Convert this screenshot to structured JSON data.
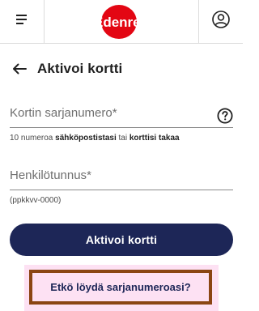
{
  "header": {
    "brand": "Edenred",
    "brand_color": "#e30613",
    "menu_icon": "hamburger-menu-icon",
    "profile_icon": "user-circle-icon"
  },
  "page": {
    "title": "Aktivoi kortti",
    "back_icon": "arrow-left-icon"
  },
  "form": {
    "serial": {
      "label": "Kortin sarjanumero",
      "required_mark": "*",
      "helper_prefix": "10 numeroa ",
      "helper_bold1": "sähköpostistasi",
      "helper_mid": " tai ",
      "helper_bold2": "korttisi takaa",
      "help_icon": "question-circle-icon"
    },
    "ssn": {
      "label": "Henkilötunnus",
      "required_mark": "*",
      "helper": "(ppkkvv-0000)"
    },
    "submit_label": "Aktivoi kortti",
    "submit_color": "#1d2657"
  },
  "help_link": {
    "label": "Etkö löydä sarjanumeroasi?"
  }
}
